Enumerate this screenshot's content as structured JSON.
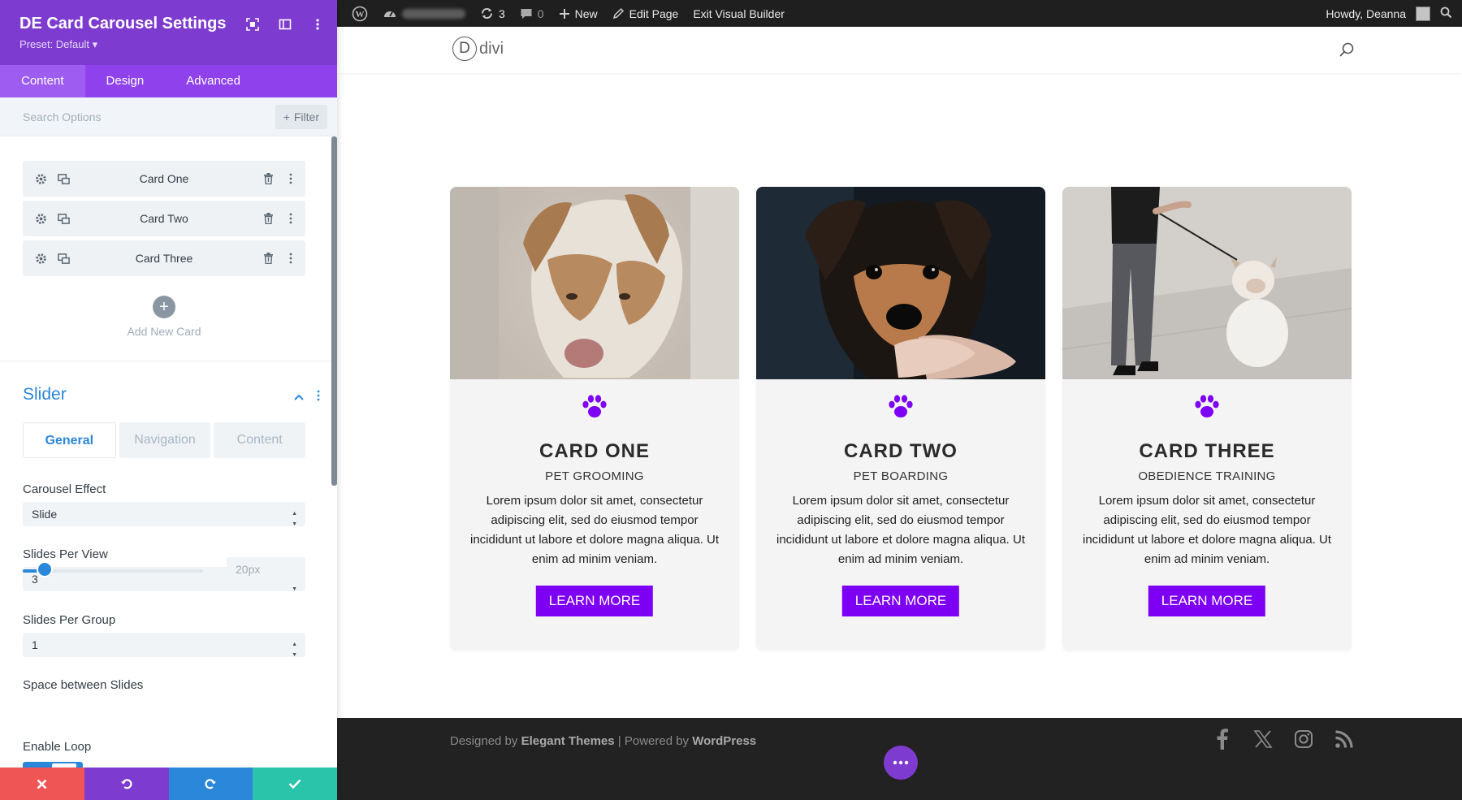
{
  "panel": {
    "title": "DE Card Carousel Settings",
    "preset": "Preset: Default ▾",
    "tabs": [
      {
        "label": "Content",
        "active": true
      },
      {
        "label": "Design",
        "active": false
      },
      {
        "label": "Advanced",
        "active": false
      }
    ],
    "search_placeholder": "Search Options",
    "filter_label": "Filter",
    "cards": [
      {
        "label": "Card One"
      },
      {
        "label": "Card Two"
      },
      {
        "label": "Card Three"
      }
    ],
    "add_card_label": "Add New Card",
    "slider": {
      "title": "Slider",
      "subtabs": [
        {
          "label": "General",
          "active": true
        },
        {
          "label": "Navigation",
          "active": false
        },
        {
          "label": "Content",
          "active": false
        }
      ],
      "carousel_effect_label": "Carousel Effect",
      "carousel_effect_value": "Slide",
      "slides_per_view_label": "Slides Per View",
      "slides_per_view_value": "3",
      "slides_per_group_label": "Slides Per Group",
      "slides_per_group_value": "1",
      "space_between_label": "Space between Slides",
      "space_between_value": "20px",
      "space_between_fraction": 0.12,
      "enable_loop_label": "Enable Loop",
      "enable_loop_on": true
    },
    "actions": [
      {
        "name": "discard",
        "color": "#ef5555"
      },
      {
        "name": "undo",
        "color": "#7e3bd0"
      },
      {
        "name": "redo",
        "color": "#2b87da"
      },
      {
        "name": "save",
        "color": "#29c4a9"
      }
    ]
  },
  "adminbar": {
    "updates_count": "3",
    "comments_count": "0",
    "new_label": "New",
    "edit_page_label": "Edit Page",
    "exit_vb_label": "Exit Visual Builder",
    "howdy_label": "Howdy, Deanna"
  },
  "site": {
    "logo_mark": "D",
    "logo_text": "divi",
    "accent_color": "#7d00f5",
    "cards": [
      {
        "title": "CARD ONE",
        "subtitle": "PET GROOMING",
        "body": "Lorem ipsum dolor sit amet, consectetur adipiscing elit, sed do eiusmod tempor incididunt ut labore et dolore magna aliqua. Ut enim ad minim veniam.",
        "button": "LEARN MORE",
        "icon": "paw-icon"
      },
      {
        "title": "CARD TWO",
        "subtitle": "PET BOARDING",
        "body": "Lorem ipsum dolor sit amet, consectetur adipiscing elit, sed do eiusmod tempor incididunt ut labore et dolore magna aliqua. Ut enim ad minim veniam.",
        "button": "LEARN MORE",
        "icon": "paw-icon"
      },
      {
        "title": "CARD THREE",
        "subtitle": "OBEDIENCE TRAINING",
        "body": "Lorem ipsum dolor sit amet, consectetur adipiscing elit, sed do eiusmod tempor incididunt ut labore et dolore magna aliqua. Ut enim ad minim veniam.",
        "button": "LEARN MORE",
        "icon": "paw-icon"
      }
    ],
    "footer": {
      "designed_by": "Designed by",
      "elegant": "Elegant Themes",
      "sep": "| Powered by",
      "wordpress": "WordPress"
    }
  }
}
